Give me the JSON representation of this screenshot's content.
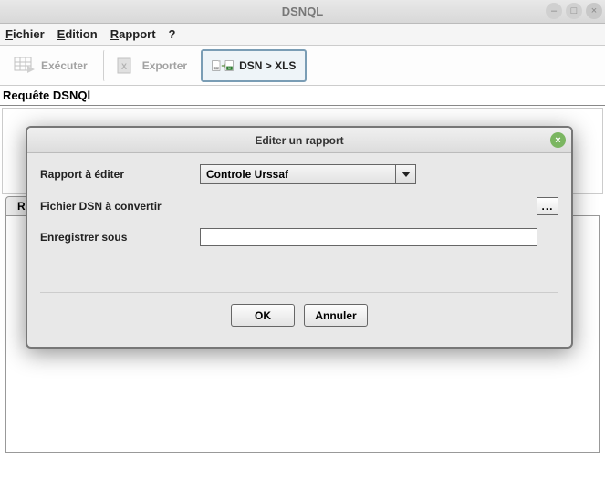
{
  "window": {
    "title": "DSNQL"
  },
  "menu": {
    "file": "Fichier",
    "edit": "Edition",
    "report": "Rapport",
    "help": "?"
  },
  "toolbar": {
    "execute": "Exécuter",
    "export": "Exporter",
    "dsn_xls": "DSN > XLS"
  },
  "labels": {
    "query_section": "Requête DSNQl",
    "result_tab": "Re"
  },
  "dialog": {
    "title": "Editer un rapport",
    "report_to_edit_label": "Rapport à éditer",
    "report_selected": "Controle Urssaf",
    "dsn_file_label": "Fichier DSN à convertir",
    "browse_btn": "...",
    "save_as_label": "Enregistrer sous",
    "save_as_value": "",
    "ok": "OK",
    "cancel": "Annuler"
  }
}
